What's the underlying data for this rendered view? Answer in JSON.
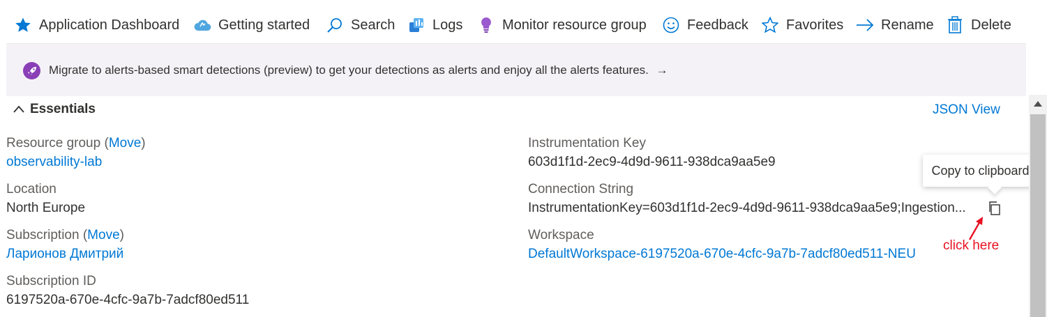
{
  "toolbar": {
    "items": [
      {
        "label": "Application Dashboard",
        "icon": "star-filled-icon"
      },
      {
        "label": "Getting started",
        "icon": "cloud-icon"
      },
      {
        "label": "Search",
        "icon": "search-icon"
      },
      {
        "label": "Logs",
        "icon": "logs-icon"
      },
      {
        "label": "Monitor resource group",
        "icon": "lightbulb-icon"
      },
      {
        "label": "Feedback",
        "icon": "smiley-icon"
      },
      {
        "label": "Favorites",
        "icon": "star-outline-icon"
      },
      {
        "label": "Rename",
        "icon": "arrow-right-icon"
      },
      {
        "label": "Delete",
        "icon": "trash-icon"
      }
    ]
  },
  "banner": {
    "message": "Migrate to alerts-based smart detections (preview) to get your detections as alerts and enjoy all the alerts features.",
    "arrow": "→"
  },
  "essentials": {
    "title": "Essentials",
    "json_view": "JSON View",
    "left": {
      "resource_group_label": "Resource group",
      "move_label": "Move",
      "resource_group_value": "observability-lab",
      "location_label": "Location",
      "location_value": "North Europe",
      "subscription_label": "Subscription",
      "subscription_move": "Move",
      "subscription_value": "Ларионов Дмитрий",
      "subscription_id_label": "Subscription ID",
      "subscription_id_value": "6197520a-670e-4cfc-9a7b-7adcf80ed511"
    },
    "right": {
      "instrumentation_key_label": "Instrumentation Key",
      "instrumentation_key_value": "603d1f1d-2ec9-4d9d-9611-938dca9aa5e9",
      "connection_string_label": "Connection String",
      "connection_string_value": "InstrumentationKey=603d1f1d-2ec9-4d9d-9611-938dca9aa5e9;Ingestion...",
      "workspace_label": "Workspace",
      "workspace_value": "DefaultWorkspace-6197520a-670e-4cfc-9a7b-7adcf80ed511-NEU"
    }
  },
  "tooltip": {
    "text": "Copy to clipboard"
  },
  "annotation": {
    "text": "click here"
  },
  "colors": {
    "link": "#0078d4",
    "banner_bg": "#f5f2f7",
    "annotation": "#e81123",
    "rocket_badge": "#8a3fb6"
  }
}
